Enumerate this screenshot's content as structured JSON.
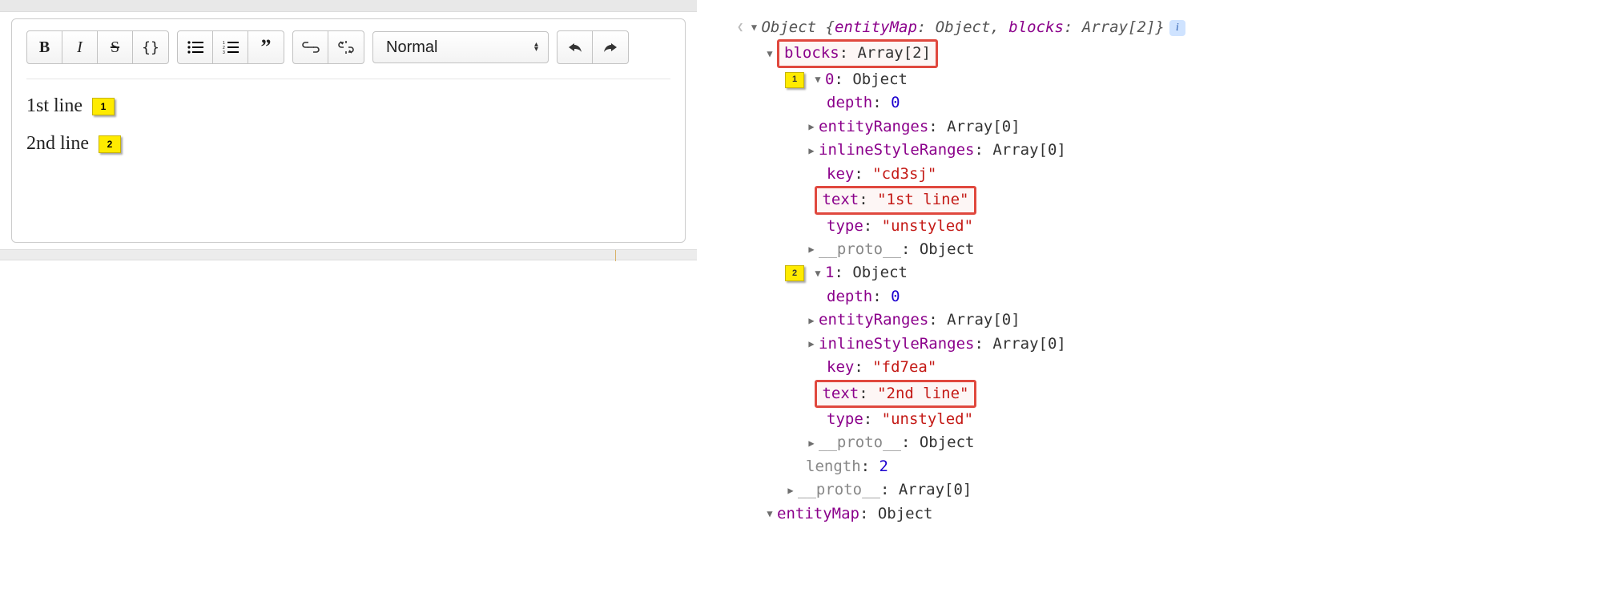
{
  "toolbar": {
    "style_select": "Normal"
  },
  "editor": {
    "lines": [
      "1st line",
      "2nd line"
    ],
    "badges": [
      "1",
      "2"
    ]
  },
  "tree": {
    "root_summary_a": "Object {",
    "root_summary_b": "entityMap",
    "root_summary_c": ": Object, ",
    "root_summary_d": "blocks",
    "root_summary_e": ": Array[2]}",
    "blocks_label": "blocks",
    "blocks_val": ": Array[2]",
    "idx0": "0",
    "idx1": "1",
    "obj_txt": ": Object",
    "depth_k": "depth",
    "depth_v": "0",
    "er_k": "entityRanges",
    "er_v": ": Array[0]",
    "isr_k": "inlineStyleRanges",
    "isr_v": ": Array[0]",
    "key_k": "key",
    "key0_v": "\"cd3sj\"",
    "key1_v": "\"fd7ea\"",
    "text_k": "text",
    "text0_v": "\"1st line\"",
    "text1_v": "\"2nd line\"",
    "type_k": "type",
    "type_v": "\"unstyled\"",
    "proto_k": "__proto__",
    "proto_obj": ": Object",
    "proto_arr": ": Array[0]",
    "length_k": "length",
    "length_v": "2",
    "em_k": "entityMap",
    "badge1": "1",
    "badge2": "2",
    "colon": ": "
  }
}
